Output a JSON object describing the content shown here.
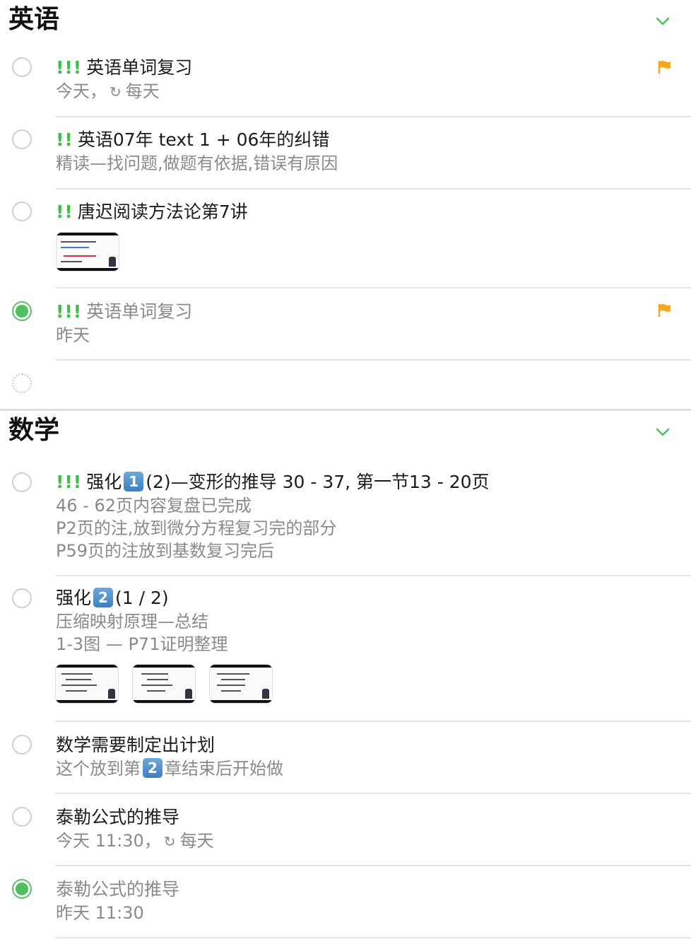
{
  "sections": [
    {
      "title": "英语",
      "items": [
        {
          "priority": "!!!",
          "title": "英语单词复习",
          "sub": [
            "今天，",
            "每天"
          ],
          "flag": true,
          "done": false
        },
        {
          "priority": "!!",
          "title": "英语07年 text 1 + 06年的纠错",
          "sub": [
            "精读—找问题,做题有依据,错误有原因"
          ],
          "done": false
        },
        {
          "priority": "!!",
          "title": "唐迟阅读方法论第7讲",
          "done": false,
          "thumbnails": 1
        },
        {
          "priority": "!!!",
          "title": "英语单词复习",
          "sub": [
            "昨天"
          ],
          "flag": true,
          "done": true
        }
      ]
    },
    {
      "title": "数学",
      "items": [
        {
          "priority": "!!!",
          "title_pre": "强化",
          "badge": "1",
          "title_post": "(2)—变形的推导 30 - 37, 第一节13 - 20页",
          "sub": [
            "46 - 62页内容复盘已完成",
            "P2页的注,放到微分方程复习完的部分",
            "P59页的注放到基数复习完后"
          ],
          "done": false
        },
        {
          "title_pre": "强化",
          "badge": "2",
          "title_post": "(1 / 2)",
          "sub": [
            "压缩映射原理—总结",
            "1-3图 — P71证明整理"
          ],
          "done": false,
          "thumbnails": 3
        },
        {
          "title": "数学需要制定出计划",
          "sub_pre": "这个放到第",
          "sub_badge": "2",
          "sub_post": "章结束后开始做",
          "done": false
        },
        {
          "title": "泰勒公式的推导",
          "sub": [
            "今天 11:30，",
            "每天"
          ],
          "done": false
        },
        {
          "title": "泰勒公式的推导",
          "sub": [
            "昨天 11:30"
          ],
          "done": true
        }
      ]
    }
  ],
  "icons": {
    "repeat": "↻",
    "flag_color": "#f5a623",
    "chevron_color": "#4cc15a",
    "done_color": "#4fbf5f",
    "priority_color": "#3fbf4a"
  }
}
